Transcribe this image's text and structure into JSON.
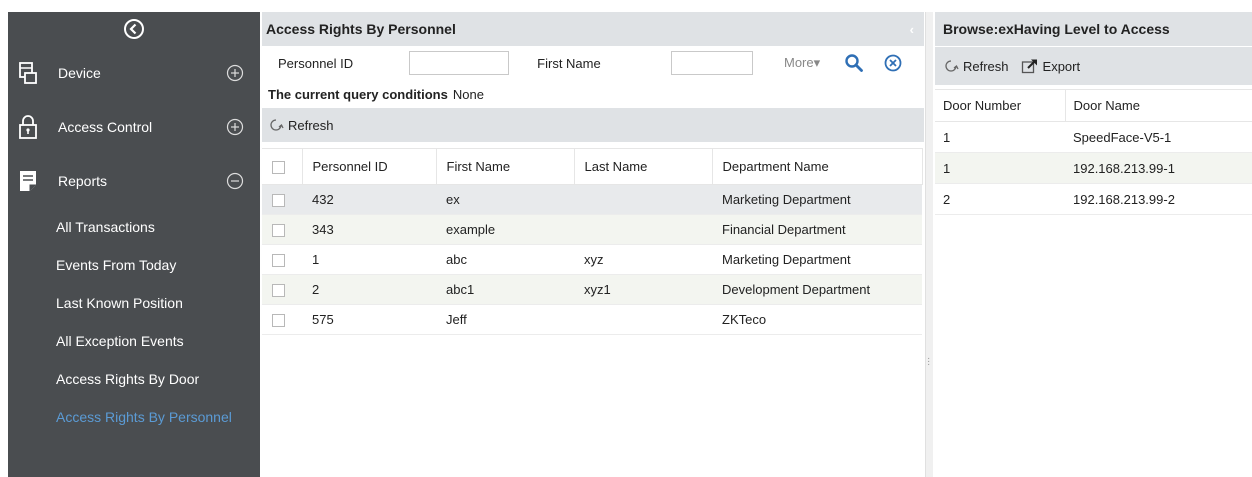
{
  "sidebar": {
    "toggle_icon": "collapse-circle-icon",
    "modules": [
      {
        "label": "Device",
        "icon": "device-icon",
        "state": "collapsed"
      },
      {
        "label": "Access Control",
        "icon": "lock-icon",
        "state": "collapsed"
      },
      {
        "label": "Reports",
        "icon": "report-icon",
        "state": "expanded"
      }
    ],
    "reports_items": [
      {
        "label": "All Transactions"
      },
      {
        "label": "Events From Today"
      },
      {
        "label": "Last Known Position"
      },
      {
        "label": "All Exception Events"
      },
      {
        "label": "Access Rights By Door"
      },
      {
        "label": "Access Rights By Personnel",
        "active": true
      }
    ],
    "active_color": "#5b9bd5"
  },
  "main": {
    "title": "Access Rights By Personnel",
    "search": {
      "personnel_id_label": "Personnel ID",
      "personnel_id_value": "",
      "first_name_label": "First Name",
      "first_name_value": "",
      "more_label": "More▾"
    },
    "query": {
      "label": "The current query conditions",
      "value": "None"
    },
    "toolbar": {
      "refresh_label": "Refresh"
    },
    "table": {
      "columns": [
        "Personnel ID",
        "First Name",
        "Last Name",
        "Department Name"
      ],
      "rows": [
        {
          "id": "432",
          "first": "ex",
          "last": "",
          "dept": "Marketing Department"
        },
        {
          "id": "343",
          "first": "example",
          "last": "",
          "dept": "Financial Department"
        },
        {
          "id": "1",
          "first": "abc",
          "last": "xyz",
          "dept": "Marketing Department"
        },
        {
          "id": "2",
          "first": "abc1",
          "last": "xyz1",
          "dept": "Development Department"
        },
        {
          "id": "575",
          "first": "Jeff",
          "last": "",
          "dept": "ZKTeco"
        }
      ]
    }
  },
  "right": {
    "title": "Browse:exHaving Level to Access",
    "toolbar": {
      "refresh_label": "Refresh",
      "export_label": "Export"
    },
    "table": {
      "columns": [
        "Door Number",
        "Door Name"
      ],
      "rows": [
        {
          "num": "1",
          "name": "SpeedFace-V5-1"
        },
        {
          "num": "1",
          "name": "192.168.213.99-1"
        },
        {
          "num": "2",
          "name": "192.168.213.99-2"
        }
      ]
    }
  },
  "colors": {
    "sidebar_bg": "#4a4d50",
    "header_bg": "#dfe2e5",
    "accent_blue": "#2f6fb5"
  }
}
